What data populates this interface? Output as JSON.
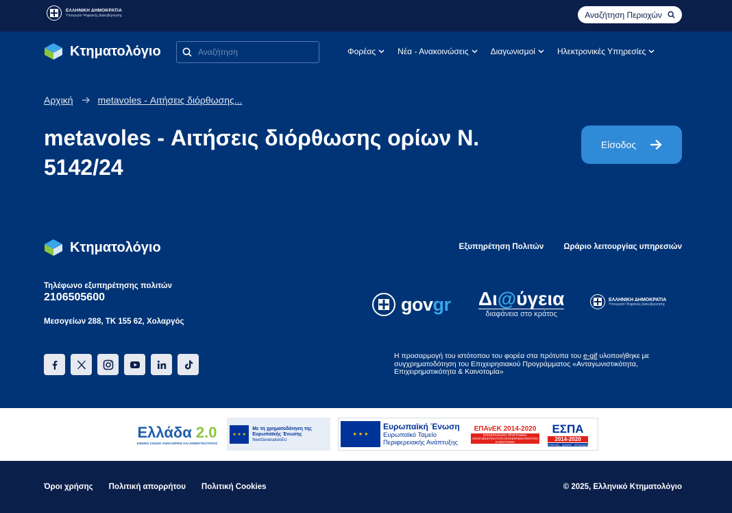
{
  "govbar": {
    "logo_line1": "ΕΛΛΗΝΙΚΗ ΔΗΜΟΚΡΑΤΙΑ",
    "logo_line2": "Υπουργείο Ψηφιακής Διακυβέρνησης",
    "region_search_label": "Αναζήτηση Περιοχών"
  },
  "header": {
    "brand": "Κτηματολόγιο",
    "search_placeholder": "Αναζήτηση",
    "nav": [
      "Φορέας",
      "Νέα - Ανακοινώσεις",
      "Διαγωνισμοί",
      "Ηλεκτρονικές Υπηρεσίες"
    ]
  },
  "breadcrumb": {
    "home": "Αρχική",
    "current": "metavoles - Αιτήσεις διόρθωσης..."
  },
  "main": {
    "title": "metavoles - Αιτήσεις διόρθωσης ορίων Ν. 5142/24",
    "login_label": "Είσοδος"
  },
  "footer": {
    "brand": "Κτηματολόγιο",
    "links": [
      "Εξυπηρέτηση Πολιτών",
      "Ωράριο λειτουργίας υπηρεσιών"
    ],
    "phone_label": "Τηλέφωνο εξυπηρέτησης πολιτών",
    "phone": "2106505600",
    "address": "Μεσογείων 288, ΤΚ 155 62, Χολαργός",
    "socials": [
      "facebook-icon",
      "x-icon",
      "instagram-icon",
      "youtube-icon",
      "linkedin-icon",
      "tiktok-icon"
    ],
    "govgr_gov": "gov",
    "govgr_gr": "gr",
    "diavgeia_pre": "Δι",
    "diavgeia_at": "@",
    "diavgeia_post": "ύγεια",
    "diavgeia_sub": "διαφάνεια στο κράτος",
    "hellenic_line1": "ΕΛΛΗΝΙΚΗ ΔΗΜΟΚΡΑΤΙΑ",
    "hellenic_line2": "Υπουργείο Ψηφιακής Διακυβέρνησης",
    "egif_pre": "Η προσαρμογή του ιστότοπου του φορέα στα πρότυπα του ",
    "egif_link": "e-gif",
    "egif_post": " υλοποιήθηκε με συγχρηματοδότηση του Επιχειρησιακού Προγράμματος «Ανταγωνιστικότητα, Επιχειρηματικότητα & Καινοτομία»"
  },
  "funding": {
    "ellada_text": "Ελλάδα",
    "ellada_num": "2.0",
    "ellada_small": "ΕΘΝΙΚΟ ΣΧΕΔΙΟ ΑΝΑΚΑΜΨΗΣ ΚΑΙ ΑΝΘΕΚΤΙΚΟΤΗΤΑΣ",
    "nextgen_line1": "Με τη χρηματοδότηση της Ευρωπαϊκής Ένωσης",
    "nextgen_line2": "NextGenerationEU",
    "eu_title": "Ευρωπαϊκή Ένωση",
    "eu_sub": "Ευρωπαϊκό Ταμείο Περιφερειακής Ανάπτυξης",
    "epanek_title": "ΕΠΑνΕΚ 2014-2020",
    "epanek_sub": "ΕΠΙΧΕΙΡΗΣΙΑΚΟ ΠΡΟΓΡΑΜΜΑ ΑΝΤΑΓΩΝΙΣΤΙΚΟΤΗΤΑ ΕΠΙΧΕΙΡΗΜΑΤΙΚΟΤΗΤΑ ΚΑΙΝΟΤΟΜΙΑ",
    "espa_title": "ΕΣΠΑ",
    "espa_years": "2014-2020",
    "espa_sub": "ανάπτυξη - εργασία - αλληλεγγύη"
  },
  "bottom": {
    "links": [
      "Όροι χρήσης",
      "Πολιτική απορρήτου",
      "Πολιτική Cookies"
    ],
    "copyright": "© 2025, Ελληνικό Κτηματολόγιο"
  },
  "colors": {
    "primary_bg": "#003476",
    "dark_bg": "#0b1f4b",
    "accent_button": "#2f8ad8",
    "gr_accent": "#3aa5e8"
  }
}
